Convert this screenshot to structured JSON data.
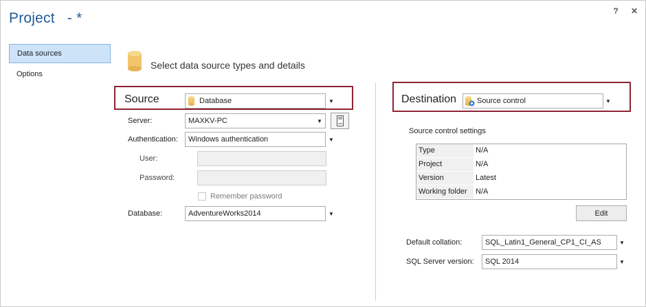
{
  "window": {
    "title": "Project",
    "modified_marker": "- *",
    "help_glyph": "?",
    "close_glyph": "✕"
  },
  "nav": {
    "items": [
      {
        "label": "Data sources",
        "active": true
      },
      {
        "label": "Options",
        "active": false
      }
    ]
  },
  "header": {
    "icon": "database-icon",
    "text": "Select data source types and details"
  },
  "source": {
    "label": "Source",
    "type_value": "Database",
    "type_icon": "database-icon",
    "server_label": "Server:",
    "server_value": "MAXKV-PC",
    "auth_label": "Authentication:",
    "auth_value": "Windows authentication",
    "user_label": "User:",
    "user_value": "",
    "password_label": "Password:",
    "password_value": "",
    "remember_label": "Remember password",
    "remember_checked": false,
    "database_label": "Database:",
    "database_value": "AdventureWorks2014"
  },
  "destination": {
    "label": "Destination",
    "type_value": "Source control",
    "type_icon": "source-control-icon",
    "settings_title": "Source control settings",
    "settings": [
      {
        "key": "Type",
        "value": "N/A"
      },
      {
        "key": "Project",
        "value": "N/A"
      },
      {
        "key": "Version",
        "value": "Latest"
      },
      {
        "key": "Working folder",
        "value": "N/A"
      }
    ],
    "edit_label": "Edit",
    "collation_label": "Default collation:",
    "collation_value": "SQL_Latin1_General_CP1_CI_AS",
    "sql_version_label": "SQL Server version:",
    "sql_version_value": "SQL 2014"
  },
  "colors": {
    "title": "#1f5a96",
    "highlight_border": "#8d2332",
    "nav_active_bg": "#cde3f8",
    "database_icon": "#f2c56b"
  }
}
